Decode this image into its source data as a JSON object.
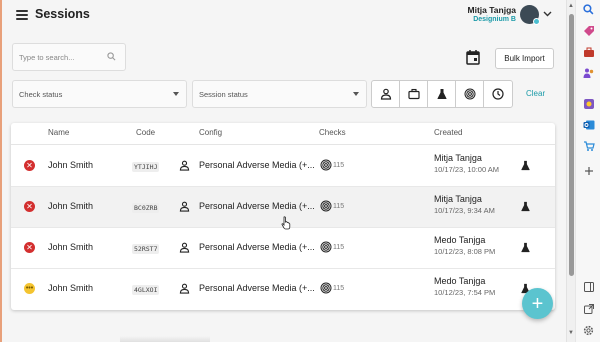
{
  "header": {
    "title": "Sessions",
    "user_name": "Mitja Tanjga",
    "user_org": "Designium B"
  },
  "toolbar": {
    "search_placeholder": "Type to search...",
    "bulk_import_label": "Bulk Import",
    "check_status_label": "Check status",
    "session_status_label": "Session status",
    "clear_label": "Clear",
    "filter_icons": [
      "person-icon",
      "briefcase-icon",
      "flask-icon",
      "fingerprint-icon",
      "clock-icon"
    ]
  },
  "table": {
    "columns": {
      "name": "Name",
      "code": "Code",
      "config": "Config",
      "checks": "Checks",
      "created": "Created"
    },
    "rows": [
      {
        "status": "failed",
        "name": "John Smith",
        "code": "YTJIHJ",
        "config": "Personal Adverse Media (+...",
        "checks": "115",
        "created_by": "Mitja Tanjga",
        "created_at": "10/17/23, 10:00 AM"
      },
      {
        "status": "failed",
        "name": "John Smith",
        "code": "BC0ZRB",
        "config": "Personal Adverse Media (+...",
        "checks": "115",
        "created_by": "Mitja Tanjga",
        "created_at": "10/17/23, 9:34 AM"
      },
      {
        "status": "failed",
        "name": "John Smith",
        "code": "52RST7",
        "config": "Personal Adverse Media (+...",
        "checks": "115",
        "created_by": "Medo Tanjga",
        "created_at": "10/12/23, 8:08 PM"
      },
      {
        "status": "pending",
        "name": "John Smith",
        "code": "4GLXOI",
        "config": "Personal Adverse Media (+...",
        "checks": "115",
        "created_by": "Medo Tanjga",
        "created_at": "10/12/23, 7:54 PM"
      }
    ]
  },
  "fab_label": "+",
  "colors": {
    "accent": "#1a9aa8",
    "fab": "#5bc4cf",
    "failed": "#d32f2f",
    "pending": "#f4c430"
  }
}
